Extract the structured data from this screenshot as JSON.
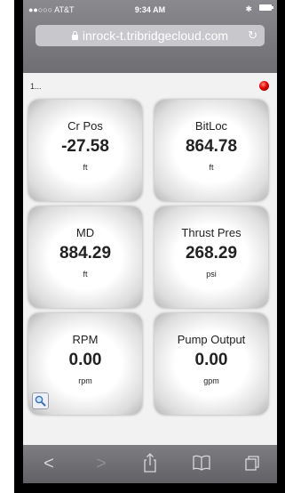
{
  "status_bar": {
    "carrier": "●●○○○ AT&T",
    "time": "9:34 AM",
    "bluetooth_icon": "bluetooth-icon",
    "battery_icon": "battery-icon"
  },
  "address_bar": {
    "url": "inrock-t.tribridgecloud.com",
    "lock_icon": "lock-icon",
    "reload_icon": "reload-icon"
  },
  "page": {
    "label": "1...",
    "status_color": "#e00000"
  },
  "tiles": [
    {
      "label": "Cr Pos",
      "value": "-27.58",
      "unit": "ft"
    },
    {
      "label": "BitLoc",
      "value": "864.78",
      "unit": "ft"
    },
    {
      "label": "MD",
      "value": "884.29",
      "unit": "ft"
    },
    {
      "label": "Thrust Pres",
      "value": "268.29",
      "unit": "psi"
    },
    {
      "label": "RPM",
      "value": "0.00",
      "unit": "rpm"
    },
    {
      "label": "Pump Output",
      "value": "0.00",
      "unit": "gpm"
    }
  ],
  "toolbar": {
    "back": "<",
    "forward": ">",
    "share_icon": "share-icon",
    "bookmarks_icon": "bookmarks-icon",
    "tabs_icon": "tabs-icon"
  }
}
